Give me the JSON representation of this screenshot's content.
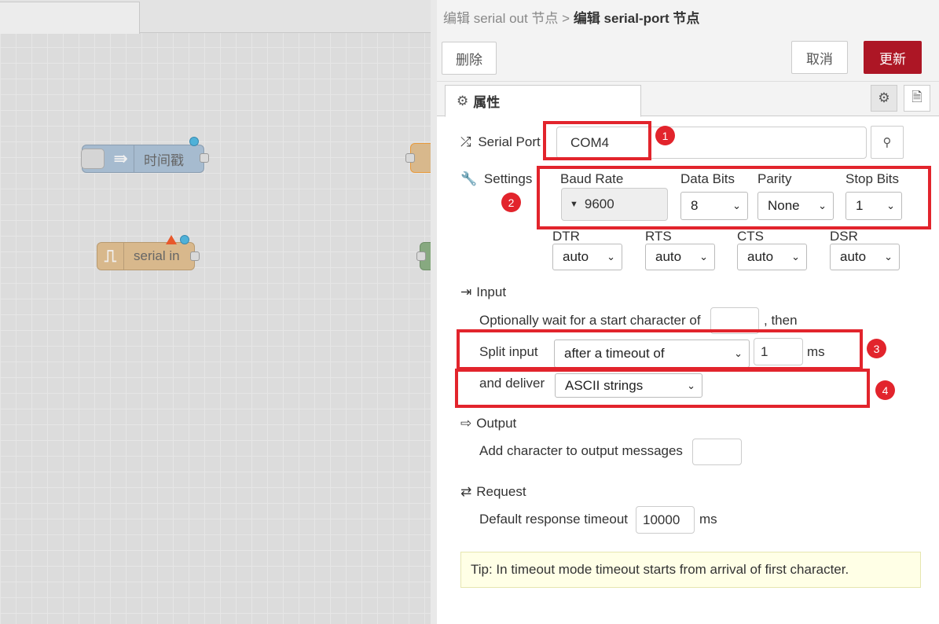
{
  "workspace": {
    "nodes": [
      {
        "id": "timestamp",
        "label": "时间戳",
        "icon": "arrow-right-icon"
      },
      {
        "id": "serial-in",
        "label": "serial in",
        "icon": "serial-wave-icon"
      }
    ]
  },
  "tray": {
    "breadcrumb_parent": "编辑 serial out 节点 >",
    "breadcrumb_current": "编辑 serial-port 节点",
    "delete_label": "删除",
    "cancel_label": "取消",
    "update_label": "更新",
    "properties_tab": "属性"
  },
  "form": {
    "serial_port_label": "Serial Port",
    "serial_port_value": "COM4",
    "settings_label": "Settings",
    "baud_rate_label": "Baud Rate",
    "baud_rate_value": "9600",
    "data_bits_label": "Data Bits",
    "data_bits_value": "8",
    "parity_label": "Parity",
    "parity_value": "None",
    "stop_bits_label": "Stop Bits",
    "stop_bits_value": "1",
    "dtr_label": "DTR",
    "dtr_value": "auto",
    "rts_label": "RTS",
    "rts_value": "auto",
    "cts_label": "CTS",
    "cts_value": "auto",
    "dsr_label": "DSR",
    "dsr_value": "auto",
    "input_title": "Input",
    "wait_text": "Optionally wait for a start character of",
    "then_text": ", then",
    "split_label": "Split input",
    "split_value": "after a timeout of",
    "split_timeout_value": "1",
    "split_unit": "ms",
    "deliver_label": "and deliver",
    "deliver_value": "ASCII strings",
    "output_title": "Output",
    "output_text": "Add character to output messages",
    "request_title": "Request",
    "response_label": "Default response timeout",
    "response_value": "10000",
    "response_unit": "ms",
    "tip": "Tip: In timeout mode timeout starts from arrival of first character."
  },
  "annotations": [
    "1",
    "2",
    "3",
    "4"
  ],
  "colors": {
    "accent": "#ad1625",
    "annotation": "#e2242c",
    "tip_bg": "#ffffe6"
  }
}
